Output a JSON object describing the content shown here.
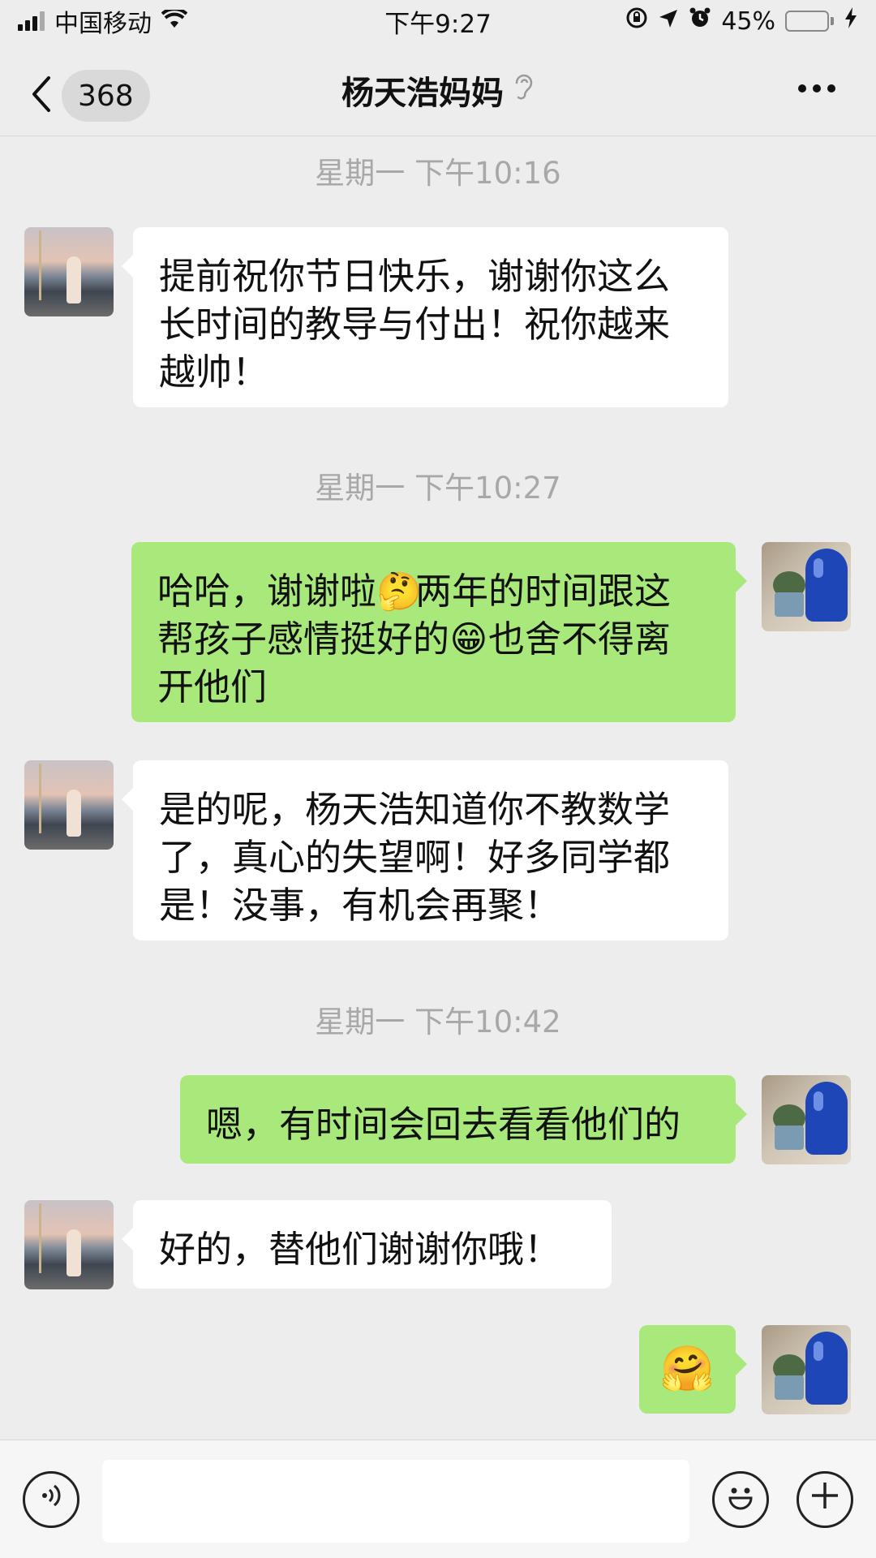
{
  "status_bar": {
    "carrier": "中国移动",
    "time": "下午9:27",
    "battery_percent": "45%",
    "battery_level": 0.45,
    "accent_color": "#4cd964"
  },
  "nav": {
    "back_count": "368",
    "title": "杨天浩妈妈",
    "icons": [
      "chevron-left-icon",
      "ear-icon",
      "more-icon"
    ]
  },
  "messages": [
    {
      "type": "timestamp",
      "text": "星期一 下午10:16"
    },
    {
      "type": "received",
      "text": "提前祝你节日快乐，谢谢你这么\n长时间的教导与付出！祝你越来\n越帅！"
    },
    {
      "type": "timestamp",
      "text": "星期一 下午10:27"
    },
    {
      "type": "sent",
      "line1a": "哈哈，谢谢啦",
      "emoji1": "🤔",
      "line1b": "两年的时间跟这",
      "line2a": "帮孩子感情挺好的",
      "emoji2": "😁",
      "line2b": "也舍不得离",
      "line3": "开他们"
    },
    {
      "type": "received",
      "text": "是的呢，杨天浩知道你不教数学\n了，真心的失望啊！好多同学都\n是！没事，有机会再聚！"
    },
    {
      "type": "timestamp",
      "text": "星期一 下午10:42"
    },
    {
      "type": "sent",
      "text": "嗯，有时间会回去看看他们的"
    },
    {
      "type": "received",
      "text": "好的，替他们谢谢你哦！"
    },
    {
      "type": "sent",
      "emoji": "🤗"
    }
  ],
  "input_bar": {
    "icons": [
      "voice-icon",
      "emoji-icon",
      "plus-icon"
    ],
    "placeholder": ""
  },
  "colors": {
    "sent_bubble": "#a9e87a",
    "received_bubble": "#ffffff",
    "background": "#ededed"
  }
}
